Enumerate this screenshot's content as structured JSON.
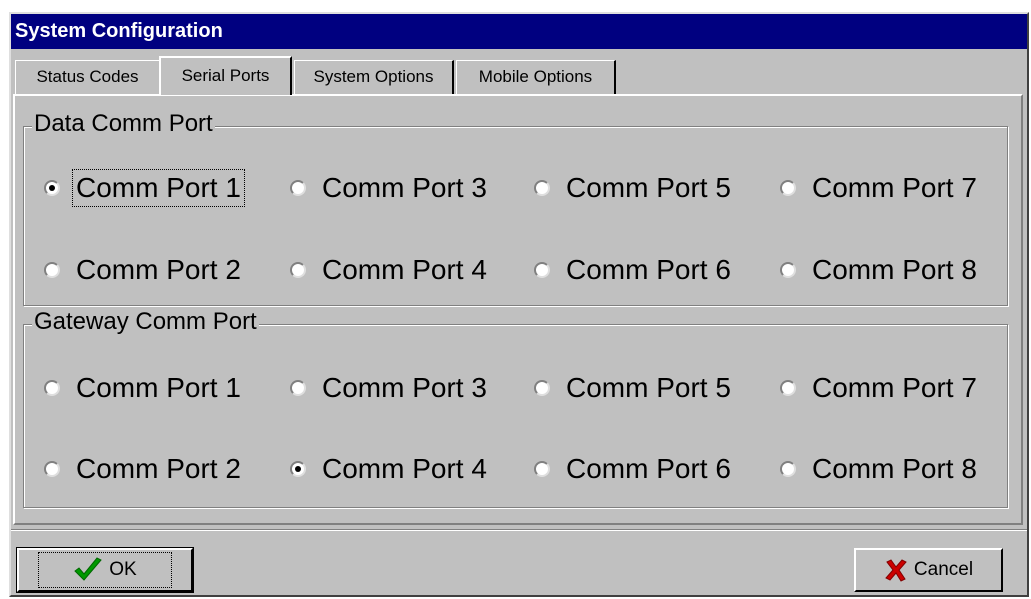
{
  "window": {
    "title": "System Configuration"
  },
  "tabs": [
    {
      "label": "Status Codes",
      "active": false
    },
    {
      "label": "Serial Ports",
      "active": true
    },
    {
      "label": "System Options",
      "active": false
    },
    {
      "label": "Mobile Options",
      "active": false
    }
  ],
  "data_comm": {
    "legend": "Data Comm Port",
    "selected": "Comm Port 1",
    "options": [
      "Comm Port 1",
      "Comm Port 3",
      "Comm Port 5",
      "Comm Port 7",
      "Comm Port 2",
      "Comm Port 4",
      "Comm Port 6",
      "Comm Port 8"
    ]
  },
  "gateway_comm": {
    "legend": "Gateway Comm Port",
    "selected": "Comm Port 4",
    "options": [
      "Comm Port 1",
      "Comm Port 3",
      "Comm Port 5",
      "Comm Port 7",
      "Comm Port 2",
      "Comm Port 4",
      "Comm Port 6",
      "Comm Port 8"
    ]
  },
  "buttons": {
    "ok": "OK",
    "cancel": "Cancel"
  },
  "colors": {
    "titlebar": "#000080",
    "face": "#c0c0c0",
    "ok_check": "#009900",
    "cancel_x": "#cc0000"
  },
  "icons": {
    "ok": "checkmark-icon",
    "cancel": "x-icon"
  }
}
